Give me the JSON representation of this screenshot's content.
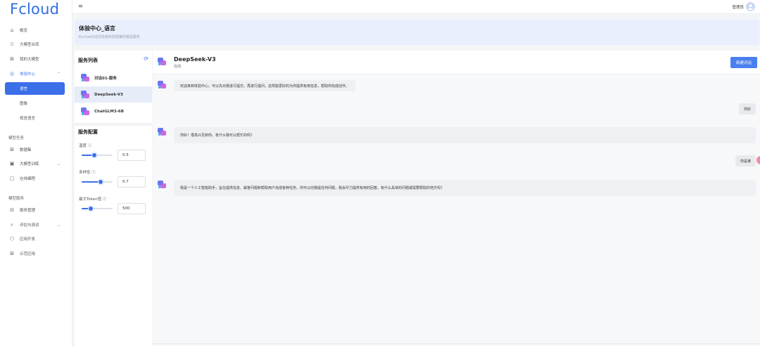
{
  "logo": "Fcloud",
  "sidebar": {
    "items": [
      {
        "icon": "home-icon",
        "glyph": "⌂",
        "label": "概览"
      },
      {
        "icon": "model-market-icon",
        "glyph": "⁞⁞",
        "label": "大模型合库"
      },
      {
        "icon": "my-model-icon",
        "glyph": "⊞",
        "label": "我的大模型"
      },
      {
        "icon": "experience-icon",
        "glyph": "◎",
        "label": "体验中心"
      }
    ],
    "experience_sub": [
      "语言",
      "图像",
      "视觉语言"
    ],
    "group_train": "模型任务",
    "train_items": [
      {
        "icon": "dataset-icon",
        "glyph": "⊞",
        "label": "数据集"
      },
      {
        "icon": "train-icon",
        "glyph": "▣",
        "label": "大模型训练"
      },
      {
        "icon": "online-code-icon",
        "glyph": "▢",
        "label": "在线编程"
      }
    ],
    "group_service": "模型服务",
    "service_items": [
      {
        "icon": "service-manage-icon",
        "glyph": "⊟",
        "label": "服务管理"
      },
      {
        "icon": "eval-icon",
        "glyph": "⌕",
        "label": "评估与测试"
      },
      {
        "icon": "app-dev-icon",
        "glyph": "⬡",
        "label": "应用开发"
      },
      {
        "icon": "demo-app-icon",
        "glyph": "⊞",
        "label": "示范应用"
      }
    ]
  },
  "topbar": {
    "menu_icon": "≡",
    "user": "管理员"
  },
  "page": {
    "title": "体验中心_语言",
    "subtitle": "Ecchat对话式快速体验部署的模型服务"
  },
  "service_list": {
    "title": "服务列表",
    "items": [
      "对话01-服务",
      "DeepSeek-V3",
      "ChatGLM3-6B"
    ],
    "active_index": 1
  },
  "config": {
    "title": "服务配置",
    "params": [
      {
        "label": "温度 ⓘ",
        "value": "0.5",
        "fraction": 0.42
      },
      {
        "label": "多样性 ⓘ",
        "value": "0.7",
        "fraction": 0.62
      },
      {
        "label": "最大Token值 ⓘ",
        "value": "500",
        "fraction": 0.3
      }
    ]
  },
  "chat": {
    "title": "DeepSeek-V3",
    "status": "在线",
    "new_chat": "新建对话",
    "messages": [
      {
        "role": "bot",
        "text": "欢迎来到体验中心。可以先对我进行提交，再进行提问，这样能更好的为你提供有用信息，帮助你完成创作。"
      },
      {
        "role": "user",
        "text": "你好"
      },
      {
        "role": "bot",
        "text": "你好！很高兴见到你。有什么我可以帮忙的吗？"
      },
      {
        "role": "user",
        "text": "你是谁"
      },
      {
        "role": "bot",
        "text": "我是一个人工智能助手，旨在提供信息、解答问题和帮助用户完成各种任务。你可以向我提任何问题，我会尽力提供有用的回答。有什么具体的问题或需要帮助的地方吗？"
      }
    ]
  }
}
